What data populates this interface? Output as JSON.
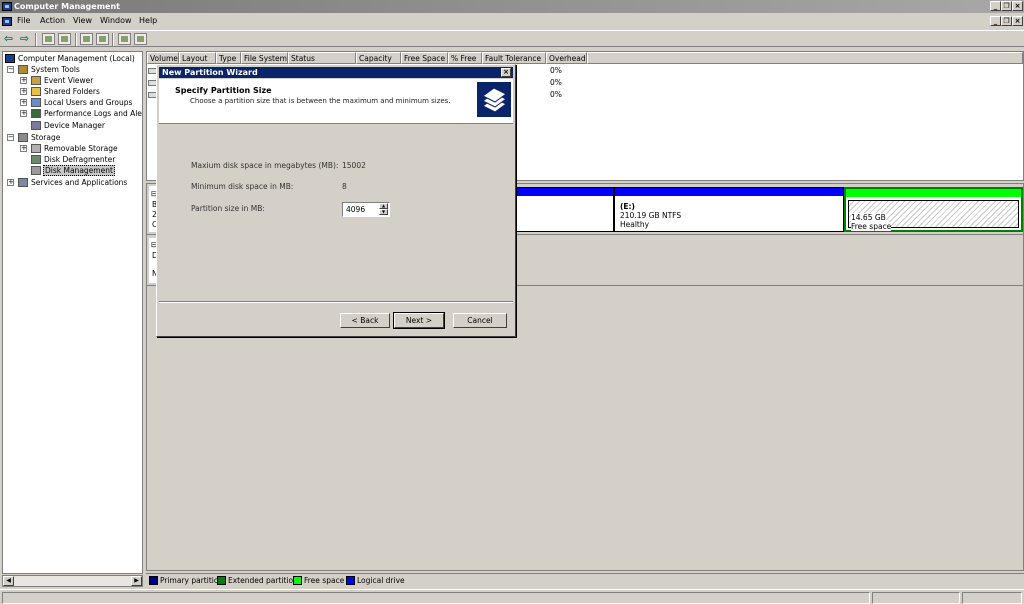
{
  "window": {
    "title": "Computer Management",
    "controls": [
      "_",
      "❐",
      "×"
    ]
  },
  "menubar": {
    "items": [
      "File",
      "Action",
      "View",
      "Window",
      "Help"
    ],
    "doc_controls": [
      "_",
      "❐",
      "×"
    ]
  },
  "tree": {
    "items": [
      {
        "label": "Computer Management (Local)",
        "icon": "computer-icon"
      },
      {
        "label": "System Tools",
        "icon": "tools-icon"
      },
      {
        "label": "Event Viewer",
        "icon": "event-viewer-icon"
      },
      {
        "label": "Shared Folders",
        "icon": "folder-icon"
      },
      {
        "label": "Local Users and Groups",
        "icon": "users-icon"
      },
      {
        "label": "Performance Logs and Alerts",
        "icon": "performance-icon"
      },
      {
        "label": "Device Manager",
        "icon": "device-manager-icon"
      },
      {
        "label": "Storage",
        "icon": "storage-icon"
      },
      {
        "label": "Removable Storage",
        "icon": "removable-storage-icon"
      },
      {
        "label": "Disk Defragmenter",
        "icon": "defragmenter-icon"
      },
      {
        "label": "Disk Management",
        "icon": "disk-management-icon"
      },
      {
        "label": "Services and Applications",
        "icon": "services-icon"
      }
    ]
  },
  "volume_list": {
    "columns": [
      "Volume",
      "Layout",
      "Type",
      "File System",
      "Status",
      "Capacity",
      "Free Space",
      "% Free",
      "Fault Tolerance",
      "Overhead"
    ],
    "overhead_values": [
      "0%",
      "0%",
      "0%"
    ]
  },
  "disk_map": {
    "disk_label_fragments": [
      "B",
      "2",
      "O"
    ],
    "disk2_label_fragments": [
      "D",
      "N"
    ],
    "partition_e": {
      "name": "(E:)",
      "size": "210.19 GB NTFS",
      "status": "Healthy"
    },
    "free_space": {
      "size": "14.65 GB",
      "label": "Free space"
    },
    "colors": {
      "primary": "#000080",
      "extended": "#008000",
      "free": "#00ff00",
      "logical": "#0000ff"
    }
  },
  "legend": {
    "items": [
      "Primary partition",
      "Extended partition",
      "Free space",
      "Logical drive"
    ]
  },
  "wizard": {
    "title": "New Partition Wizard",
    "close": "×",
    "header_title": "Specify Partition Size",
    "header_subtitle": "Choose a partition size that is between the maximum and minimum sizes.",
    "max_label": "Maxium disk space in megabytes (MB):",
    "max_value": "15002",
    "min_label": "Minimum disk space in MB:",
    "min_value": "8",
    "size_label": "Partition size in MB:",
    "size_value": "4096",
    "back_label": "< Back",
    "next_label": "Next >",
    "cancel_label": "Cancel"
  }
}
